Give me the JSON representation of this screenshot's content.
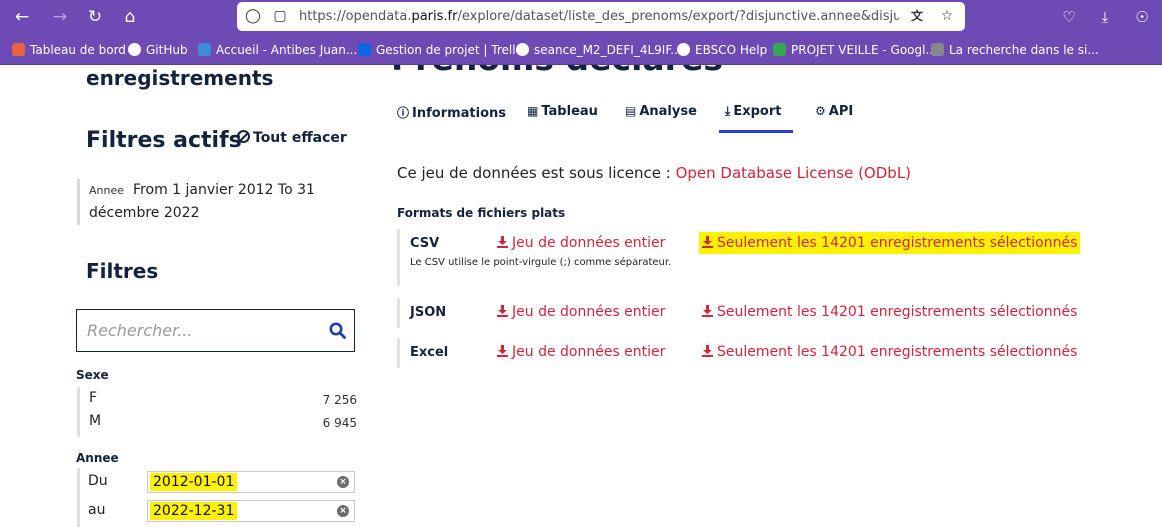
{
  "browser": {
    "url_prefix": "https://opendata.",
    "url_domain": "paris.fr",
    "url_path": "/explore/dataset/liste_des_prenoms/export/?disjunctive.annee&disjunctive.p",
    "bookmarks": [
      {
        "label": "Tableau de bord",
        "color": "#e8643c"
      },
      {
        "label": "GitHub",
        "color": "#ffffff"
      },
      {
        "label": "Accueil - Antibes Juan...",
        "color": "#3c8dd8"
      },
      {
        "label": "Gestion de projet | Trello",
        "color": "#0c66e4"
      },
      {
        "label": "seance_M2_DEFI_4L9IF...",
        "color": "#ffffff"
      },
      {
        "label": "EBSCO Help",
        "color": "#ffffff"
      },
      {
        "label": "PROJET VEILLE - Googl...",
        "color": "#34a853"
      },
      {
        "label": "La recherche dans le si...",
        "color": "#888888"
      }
    ]
  },
  "sidebar": {
    "records_heading": "enregistrements",
    "active_filters_title": "Filtres actifs",
    "clear_all_label": "Tout effacer",
    "active_filter": {
      "key": "Annee",
      "value": "From 1 janvier 2012 To 31 décembre 2022"
    },
    "filters_title": "Filtres",
    "search_placeholder": "Rechercher...",
    "facet_sexe": {
      "title": "Sexe",
      "items": [
        {
          "label": "F",
          "count": "7 256"
        },
        {
          "label": "M",
          "count": "6 945"
        }
      ]
    },
    "facet_annee": {
      "title": "Annee",
      "from_label": "Du",
      "from_value": "2012-01-01",
      "to_label": "au",
      "to_value": "2022-12-31"
    }
  },
  "main": {
    "title_partial": "Prénoms déclarés",
    "tabs": [
      {
        "label": "Informations",
        "icon": "info-icon"
      },
      {
        "label": "Tableau",
        "icon": "table-icon"
      },
      {
        "label": "Analyse",
        "icon": "chart-icon"
      },
      {
        "label": "Export",
        "icon": "download-icon",
        "active": true
      },
      {
        "label": "API",
        "icon": "gears-icon"
      }
    ],
    "license_text": "Ce jeu de données est sous licence :",
    "license_link": "Open Database License (ODbL)",
    "formats_title": "Formats de fichiers plats",
    "formats": [
      {
        "name": "CSV",
        "full": "Jeu de données entier",
        "selected": "Seulement les 14201 enregistrements sélectionnés",
        "note": "Le CSV utilise le point-virgule (;) comme séparateur."
      },
      {
        "name": "JSON",
        "full": "Jeu de données entier",
        "selected": "Seulement les 14201 enregistrements sélectionnés"
      },
      {
        "name": "Excel",
        "full": "Jeu de données entier",
        "selected": "Seulement les 14201 enregistrements sélectionnés"
      }
    ]
  },
  "colors": {
    "accent_red": "#d0263a",
    "navy": "#14233d",
    "highlight": "#fff200",
    "tab_active": "#2b3bd6",
    "browser": "#6e4bb4"
  }
}
